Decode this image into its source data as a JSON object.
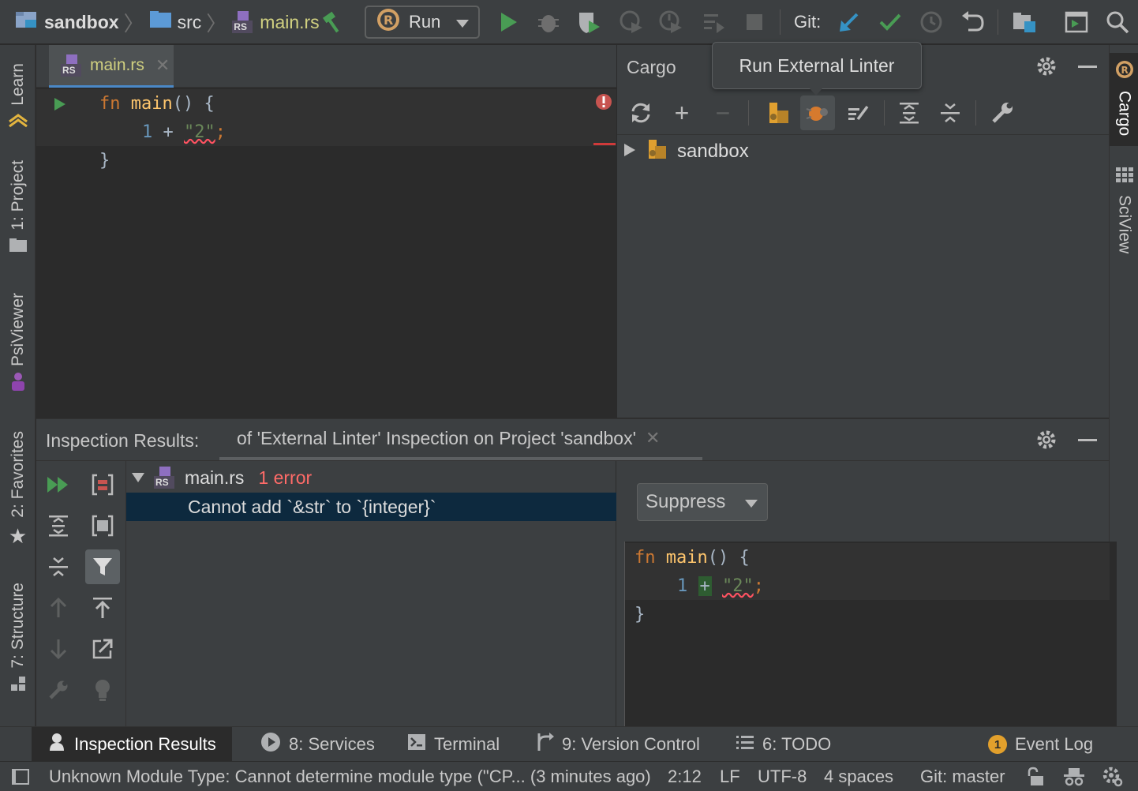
{
  "breadcrumb": {
    "project": "sandbox",
    "folder": "src",
    "file": "main.rs",
    "file_badge": "RS"
  },
  "toolbar": {
    "run_config": "Run",
    "git_label": "Git:"
  },
  "editor": {
    "tab_label": "main.rs",
    "tab_badge": "RS",
    "code": {
      "l1_kw": "fn",
      "l1_fn": "main",
      "l1_rest": "() {",
      "l2_num": "1",
      "l2_op": " + ",
      "l2_str": "\"2\"",
      "l2_end": ";",
      "l3": "}"
    }
  },
  "cargo": {
    "title": "Cargo",
    "tree_root": "sandbox"
  },
  "tooltip": {
    "text": "Run External Linter"
  },
  "left_tabs": {
    "learn": "Learn",
    "project": "1: Project",
    "psiviewer": "PsiViewer",
    "favorites": "2: Favorites",
    "structure": "7: Structure"
  },
  "right_tabs": {
    "cargo": "Cargo",
    "sciview": "SciView"
  },
  "inspection": {
    "title": "Inspection Results:",
    "tab_label": "of 'External Linter' Inspection on Project 'sandbox'",
    "file": "main.rs",
    "file_badge": "RS",
    "error_count": "1 error",
    "message": "Cannot add `&str` to `{integer}`",
    "suppress_label": "Suppress",
    "code": {
      "l1_kw": "fn",
      "l1_fn": "main",
      "l1_rest": "() {",
      "l2_num": "1",
      "l2_op": "+",
      "l2_str": "\"2\"",
      "l2_end": ";",
      "l3": "}"
    }
  },
  "bottom_tabs": {
    "inspection_results": "Inspection Results",
    "services": "8: Services",
    "terminal": "Terminal",
    "version_control": "9: Version Control",
    "todo": "6: TODO",
    "event_log": "Event Log",
    "event_count": "1"
  },
  "statusbar": {
    "message": "Unknown Module Type: Cannot determine module type (\"CP... (3 minutes ago)",
    "position": "2:12",
    "line_sep": "LF",
    "encoding": "UTF-8",
    "indent": "4 spaces",
    "git_branch": "Git: master"
  },
  "colors": {
    "accent": "#4a88c7",
    "error": "#ff6b68",
    "run_green": "#499c54",
    "selection": "#0d293e"
  }
}
